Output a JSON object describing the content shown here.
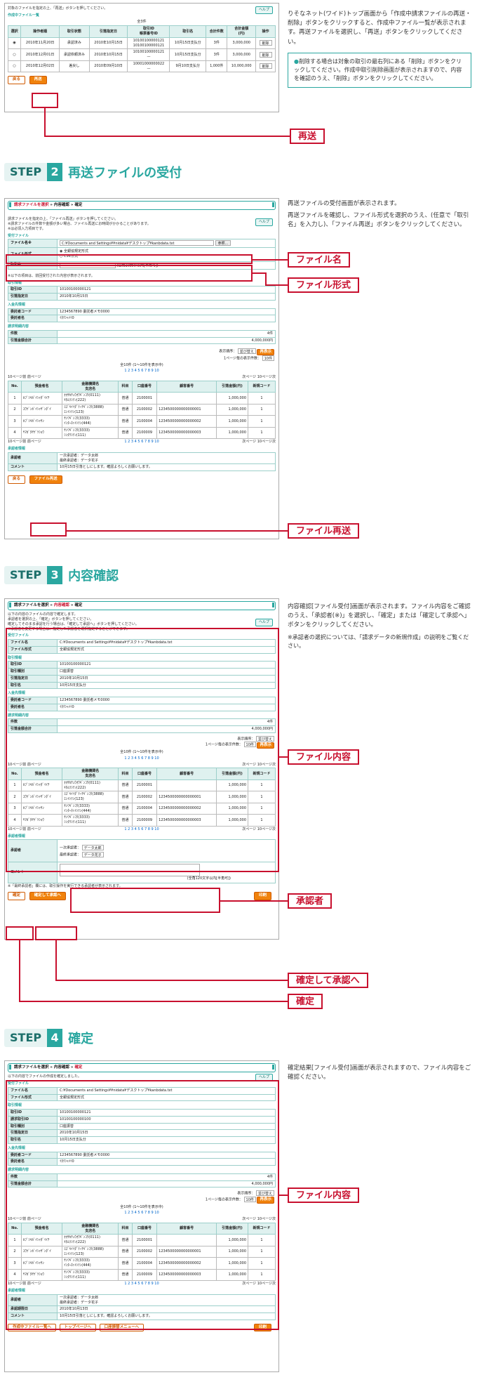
{
  "step1": {
    "intro": "対象のファイルを指定の上、「再送」ボタンを押してください。",
    "section": "作成中ファイル一覧",
    "total": "全3件",
    "help": "ヘルプ",
    "columns": [
      "選択",
      "操作者順",
      "取引状態",
      "引落指定日",
      "取引ID\n帳票番号ID",
      "取引名",
      "合計件数",
      "合計金額\n(円)",
      "操作"
    ],
    "rows": [
      [
        "2010年11月20日",
        "承認済み",
        "2010年10月15日",
        "10100100000121\n10100100000121",
        "10月15日支払分",
        "3件",
        "3,000,000",
        "削除"
      ],
      [
        "2010年12月01日",
        "承認依頼済み",
        "2010年10月15日",
        "10100100000121\n—",
        "10月15日支払分",
        "3件",
        "3,000,000",
        "削除"
      ],
      [
        "2010年12月02日",
        "差戻し",
        "2010年09月10日",
        "10001000000022\n—",
        "9月10日支払分",
        "1,000件",
        "10,000,000",
        "削除"
      ]
    ],
    "back_btn": "戻る",
    "resend_btn": "再送",
    "desc": "りそなネット(ワイド)トップ画面から「作成中請求ファイルの再送・削除」ボタンをクリックすると、作成中ファイル一覧が表示されます。再送ファイルを選択し、「再送」ボタンをクリックしてください。",
    "note": "削除する場合は対象の取引の最右列にある「削除」ボタンをクリックしてください。作成中取引削除画面が表示されますので、内容を確認のうえ、「削除」ボタンをクリックしてください。",
    "callout_resend": "再送"
  },
  "step2": {
    "step_label": "STEP",
    "num": "2",
    "title": "再送ファイルの受付",
    "crumb": [
      "請求ファイルを選択",
      "内容確認",
      "確定"
    ],
    "help": "ヘルプ",
    "intro": "請求ファイルを指定の上、「ファイル再送」ボタンを押してください。\n※請求ファイルの件数や金額が多い場合、ファイル再送にお時間がかかることがあります。\n※は必須入力項目です。",
    "sec_file": "受付ファイル",
    "file_name_label": "ファイル名※",
    "file_path": "C:¥Documents and Settings¥¥nidata¥デスクトップ¥kanbdata.txt",
    "ref_btn": "参照...",
    "file_fmt_label": "ファイル形式",
    "fmt_opt1": "全銀協規定形式",
    "fmt_opt2": "CSV形式",
    "torihiki_label": "取引名",
    "torihiki_hint": "(全角10文字以内[半角可])",
    "note_prev": "※以下の項目は、前回受付された内容が表示されます。",
    "sec_tori": "取引情報",
    "tori_rows": [
      [
        "取引ID",
        "10100100000121"
      ],
      [
        "引落指定日",
        "2010年10月15日"
      ]
    ],
    "sec_nyukin": "入金先情報",
    "nyukin_rows": [
      [
        "委託者コード",
        "1234567890 委託者メモ0000"
      ],
      [
        "委託者名",
        "ｲﾀｸｼｬﾒｲ0"
      ]
    ],
    "sec_meisai": "請求明細内容",
    "meisai_rows": [
      [
        "件数",
        "4件"
      ],
      [
        "引落金額合計",
        "4,000,000円"
      ]
    ],
    "sort_label": "表示順序：",
    "sort_val": "並び替え",
    "per_page_label": "1ページ毎の表示件数：",
    "per_page_val": "10件",
    "redisplay": "再表示",
    "page_info": "全10件 (1〜10件を表示中)",
    "pages": "1 2 3 4 5 6 7 8 9 10",
    "prev10": "10ページ前",
    "prev": "前ページ",
    "next": "次ページ",
    "next10": "10ページ次",
    "grid_cols": [
      "No.",
      "預金者名",
      "金融機関名\n支店名",
      "科目",
      "口座番号",
      "顧客番号",
      "引落金額(円)",
      "新規コード"
    ],
    "grid_rows": [
      [
        "1",
        "ｶﾌﾞｼｷｶﾞｲｼｬﾀﾞｲｲﾁ",
        "ｵｵｻｶﾁｭｳｵｳｷﾞﾝｺｳ(0111)\nｷﾀﾑﾗｼﾃﾝ(222)",
        "普通",
        "2100001",
        "",
        "1,000,000",
        "1"
      ],
      [
        "2",
        "ﾕｳｹﾞﾝｶﾞｲｼｬｻﾞﾝﾀﾞｲ",
        "ｽｽﾞｷｲｲﾀﾞﾃｰﾁｷﾞﾝｺｳ(3888)\nｴﾝﾄｼﾃﾝ(123)",
        "普通",
        "2100002",
        "1234500000000000001",
        "1,000,000",
        "1"
      ],
      [
        "3",
        "ｶﾌﾞｼｷｶﾞｲｼｬｻﾝ",
        "ｻﾝﾜｷﾞﾝｺｳ(3333)\nｲﾝﾀｰﾈｯﾄｼﾃﾝ(444)",
        "普通",
        "2100004",
        "1234500000000000002",
        "1,000,000",
        "1"
      ],
      [
        "4",
        "ﾔﾏｶﾞﾀﾔｹﾞﾂｼｮｳ",
        "ｻﾝﾜｷﾞﾝｺｳ(3333)\nｼﾝﾀﾜｼﾃﾝ(111)",
        "普通",
        "2100009",
        "1234500000000000003",
        "1,000,000",
        "1"
      ]
    ],
    "sec_approver": "承認者情報",
    "approver_label": "承認者",
    "approver_val": "一次承認者：データ太郎\n最終承認者：データ花子",
    "comment_label": "コメント",
    "comment_val": "10月15日引落としにします。確認よろしくお願いします。",
    "back_btn": "戻る",
    "resend_btn": "ファイル再送",
    "desc1": "再送ファイルの受付画面が表示されます。",
    "desc2": "再送ファイルを確認し、ファイル形式を選択のうえ、(任意で「取引名」を入力し)、「ファイル再送」ボタンをクリックしてください。",
    "callout_name": "ファイル名",
    "callout_fmt": "ファイル形式",
    "callout_resend": "ファイル再送"
  },
  "step3": {
    "step_label": "STEP",
    "num": "3",
    "title": "内容確認",
    "crumb": [
      "請求ファイルを選択",
      "内容確認",
      "確定"
    ],
    "help": "ヘルプ",
    "intro": "以下の内容のファイルの内容で確定します。\n承認者を選択の上、「確定」ボタンを押してください。\n確定してそのまま承認を行う場合は、「確定して承認へ」ボタンを押してください。\n※承認者を変更する場合は、指定した承認者を選択指定することができます。",
    "sec_file": "受付ファイル",
    "file_rows": [
      [
        "ファイル名",
        "C:¥Documents and Settings¥¥nidata¥デスクトップ¥kanbdata.txt"
      ],
      [
        "ファイル形式",
        "全銀協規定形式"
      ]
    ],
    "sec_tori": "取引情報",
    "tori_rows": [
      [
        "取引ID",
        "10100100000121"
      ],
      [
        "取引種別",
        "口座振替"
      ],
      [
        "引落指定日",
        "2010年10月15日"
      ],
      [
        "取引名",
        "10月15日支払分"
      ]
    ],
    "sec_nyukin": "入金先情報",
    "nyukin_rows": [
      [
        "委託者コード",
        "1234567890 委託者メモ0000"
      ],
      [
        "委託者名",
        "ｲﾀｸｼｬﾒｲ0"
      ]
    ],
    "sec_meisai": "請求明細内容",
    "meisai_rows": [
      [
        "件数",
        "4件"
      ],
      [
        "引落金額合計",
        "4,000,000円"
      ]
    ],
    "sec_approver": "承認者情報",
    "approver_label": "承認者",
    "approver_l1": "一次承認者：",
    "approver_v1": "データ太郎",
    "approver_l2": "最終承認者：",
    "approver_v2": "データ花子",
    "comment_label": "コメント",
    "comment_hint": "(全角120文字以内[半角可])",
    "note_bottom": "※「最終承認者」欄には、取引操作を実行できる承認者が表示されます。",
    "back_btn": "戻る",
    "confirm_approve_btn": "確定して承認へ",
    "confirm_btn": "確定",
    "print_btn": "印刷",
    "desc": "内容確認[ファイル受付]画面が表示されます。ファイル内容をご確認のうえ、「承認者(※)」を選択し、「確定」または「確定して承認へ」ボタンをクリックしてください。",
    "desc_note": "※承認者の選択については、「請求データの新規作成」の説明をご覧ください。",
    "callout_content": "ファイル内容",
    "callout_approver": "承認者",
    "callout_confirm_approve": "確定して承認へ",
    "callout_confirm": "確定"
  },
  "step4": {
    "step_label": "STEP",
    "num": "4",
    "title": "確定",
    "crumb": [
      "請求ファイルを選択",
      "内容確認",
      "確定"
    ],
    "help": "ヘルプ",
    "intro": "以下の内容でファイルの作成を確定しました。",
    "sec_file": "受付ファイル",
    "file_rows": [
      [
        "ファイル名",
        "C:¥Documents and Settings¥¥nidata¥デスクトップ¥kanbdata.txt"
      ],
      [
        "ファイル形式",
        "全銀協規定形式"
      ]
    ],
    "sec_tori": "取引情報",
    "tori_rows": [
      [
        "取引ID",
        "10100100000121"
      ],
      [
        "請求取引ID",
        "10100100000100"
      ],
      [
        "取引種別",
        "口座振替"
      ],
      [
        "引落指定日",
        "2010年10月15日"
      ],
      [
        "取引名",
        "10月15日支払分"
      ]
    ],
    "sec_nyukin": "入金先情報",
    "nyukin_rows": [
      [
        "委託者コード",
        "1234567890 委託者メモ0000"
      ],
      [
        "委託者名",
        "ｲﾀｸｼｬﾒｲ0"
      ]
    ],
    "sec_meisai": "請求明細内容",
    "meisai_rows": [
      [
        "件数",
        "4件"
      ],
      [
        "引落金額合計",
        "4,000,000円"
      ]
    ],
    "sec_approver": "承認者情報",
    "app_rows": [
      [
        "承認者",
        "一次承認者：データ太郎\n最終承認者：データ花子"
      ],
      [
        "承認期限日",
        "2010年10月13日"
      ],
      [
        "コメント",
        "10月15日引落としにします。確認よろしくお願いします。"
      ]
    ],
    "btn1": "作成中ファイル一覧へ",
    "btn2": "トップページへ",
    "btn3": "口座振替メニューへ",
    "print_btn": "印刷",
    "desc": "確定結果[ファイル受付]画面が表示されますので、ファイル内容をご確認ください。",
    "callout_content": "ファイル内容"
  }
}
